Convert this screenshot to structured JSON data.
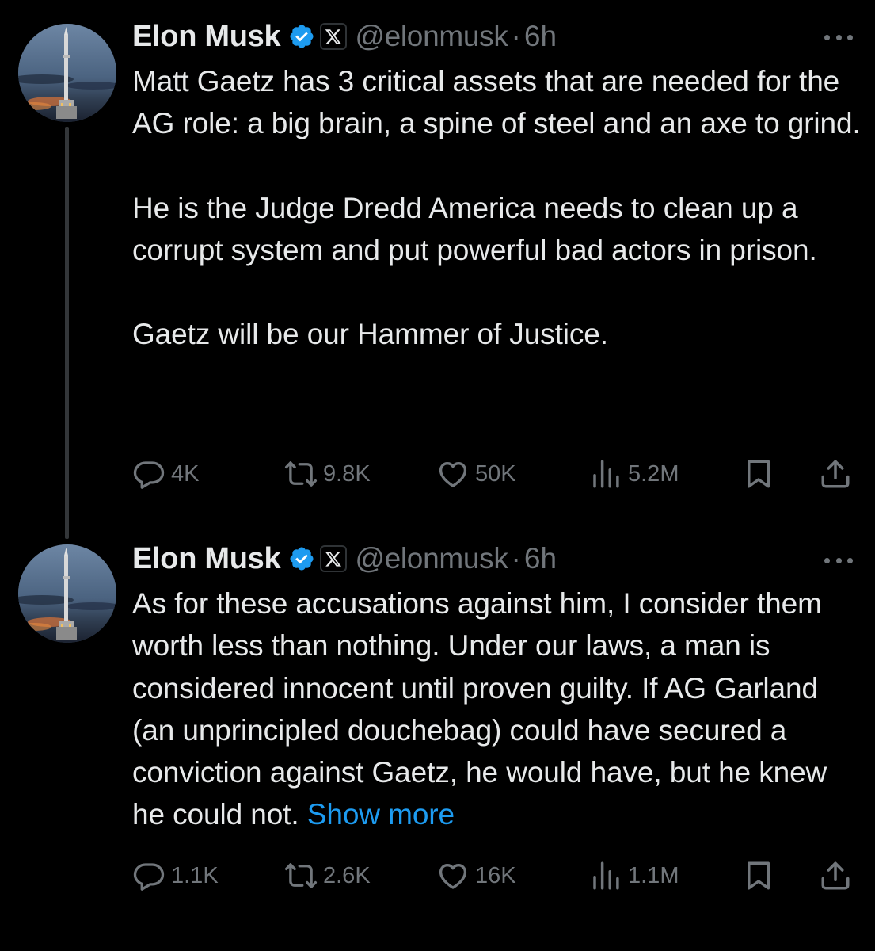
{
  "tweets": [
    {
      "author_name": "Elon Musk",
      "handle": "@elonmusk",
      "separator": "·",
      "time": "6h",
      "paragraphs": [
        "Matt Gaetz has 3 critical assets that are needed for the AG role: a big brain, a spine of steel and an axe to grind.",
        "He is the Judge Dredd America needs to clean up a corrupt system and put powerful bad actors in prison.",
        "Gaetz will be our Hammer of Justice."
      ],
      "show_more": "",
      "stats": {
        "replies": "4K",
        "reposts": "9.8K",
        "likes": "50K",
        "views": "5.2M"
      }
    },
    {
      "author_name": "Elon Musk",
      "handle": "@elonmusk",
      "separator": "·",
      "time": "6h",
      "paragraphs": [
        "As for these accusations against him, I consider them worth less than nothing. Under our laws, a man is considered innocent until proven guilty. If AG Garland (an unprincipled douchebag) could have secured a conviction against Gaetz, he would have, but he knew he could not. "
      ],
      "show_more": "Show more",
      "stats": {
        "replies": "1.1K",
        "reposts": "2.6K",
        "likes": "16K",
        "views": "1.1M"
      }
    }
  ],
  "icons": {
    "verified": "verified-badge-icon",
    "affiliate": "x-logo-icon",
    "more": "more-dots-icon",
    "reply": "reply-icon",
    "repost": "repost-icon",
    "like": "heart-icon",
    "views": "views-icon",
    "bookmark": "bookmark-icon",
    "share": "share-icon"
  },
  "colors": {
    "background": "#000000",
    "text": "#e7e9ea",
    "muted": "#71767b",
    "accent": "#1d9bf0"
  }
}
